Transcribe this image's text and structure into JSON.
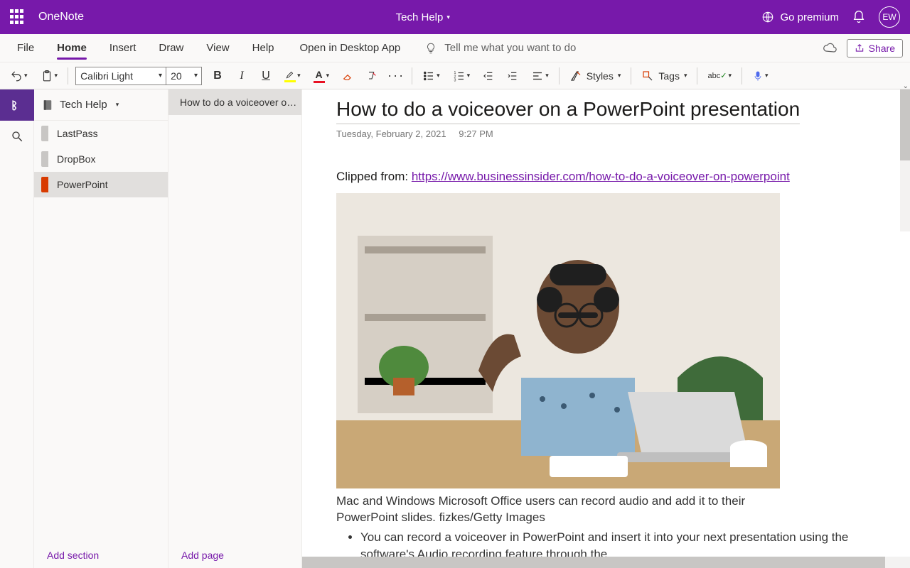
{
  "title_bar": {
    "app_name": "OneNote",
    "notebook_dropdown": "Tech Help",
    "premium_label": "Go premium",
    "avatar_initials": "EW"
  },
  "tabs": {
    "file": "File",
    "home": "Home",
    "insert": "Insert",
    "draw": "Draw",
    "view": "View",
    "help": "Help",
    "open_desktop": "Open in Desktop App",
    "tell_me_placeholder": "Tell me what you want to do",
    "share": "Share"
  },
  "toolbar": {
    "font_name": "Calibri Light",
    "font_size": "20",
    "styles_label": "Styles",
    "tags_label": "Tags"
  },
  "nav": {
    "notebook_name": "Tech Help",
    "sections": [
      {
        "label": "LastPass"
      },
      {
        "label": "DropBox"
      },
      {
        "label": "PowerPoint"
      }
    ],
    "active_section_index": 2,
    "pages": [
      {
        "label": "How to do a voiceover o…"
      }
    ],
    "active_page_index": 0,
    "add_section": "Add section",
    "add_page": "Add page"
  },
  "page": {
    "title": "How to do a voiceover on a PowerPoint presentation",
    "date": "Tuesday, February 2, 2021",
    "time": "9:27 PM",
    "clip_prefix": "Clipped from: ",
    "clip_url": "https://www.businessinsider.com/how-to-do-a-voiceover-on-powerpoint",
    "caption": "Mac and Windows Microsoft Office users can record audio and add it to their PowerPoint slides. fizkes/Getty Images",
    "bullet1": "You can record a voiceover in PowerPoint and insert it into your next presentation using the software's Audio recording feature through the"
  }
}
